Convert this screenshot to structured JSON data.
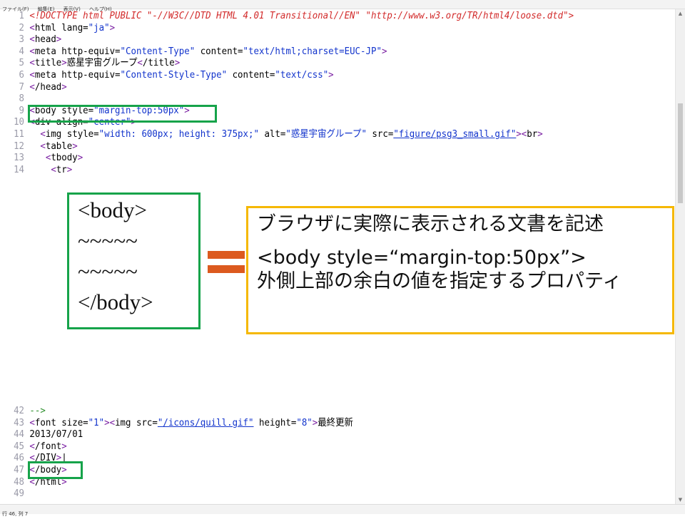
{
  "menu": [
    "ファイル(F)",
    "編集(E)",
    "表示(V)",
    "ヘルプ(H)"
  ],
  "status": "行 46, 列 7",
  "code_top": [
    {
      "n": "1",
      "html": "<span class=\"doctype\">&lt;!DOCTYPE html PUBLIC \"-//W3C//DTD HTML 4.01 Transitional//EN\" \"http://www.w3.org/TR/html4/loose.dtd\"&gt;</span>"
    },
    {
      "n": "2",
      "html": "<span class=\"bracket\">&lt;</span>html lang=<span class=\"val\">\"ja\"</span><span class=\"bracket\">&gt;</span>"
    },
    {
      "n": "3",
      "html": "<span class=\"bracket\">&lt;</span>head<span class=\"bracket\">&gt;</span>"
    },
    {
      "n": "4",
      "html": "<span class=\"bracket\">&lt;</span>meta http-equiv=<span class=\"val\">\"Content-Type\"</span> content=<span class=\"val\">\"text/html;charset=EUC-JP\"</span><span class=\"bracket\">&gt;</span>"
    },
    {
      "n": "5",
      "html": "<span class=\"bracket\">&lt;</span>title<span class=\"bracket\">&gt;</span>惑星宇宙グループ<span class=\"bracket\">&lt;</span>/title<span class=\"bracket\">&gt;</span>"
    },
    {
      "n": "6",
      "html": "<span class=\"bracket\">&lt;</span>meta http-equiv=<span class=\"val\">\"Content-Style-Type\"</span> content=<span class=\"val\">\"text/css\"</span><span class=\"bracket\">&gt;</span>"
    },
    {
      "n": "7",
      "html": "<span class=\"bracket\">&lt;</span>/head<span class=\"bracket\">&gt;</span>"
    },
    {
      "n": "8",
      "html": ""
    },
    {
      "n": "9",
      "html": "<span class=\"bracket\">&lt;</span>body style=<span class=\"val\">\"margin-top:50px\"</span><span class=\"bracket\">&gt;</span>"
    },
    {
      "n": "10",
      "html": "<span class=\"bracket\">&lt;</span>div align=<span class=\"val\">\"center\"</span><span class=\"bracket\">&gt;</span>"
    },
    {
      "n": "11",
      "html": "  <span class=\"bracket\">&lt;</span>img style=<span class=\"val\">\"width: 600px; height: 375px;\"</span> alt=<span class=\"val\">\"惑星宇宙グループ\"</span> src=<span class=\"link\">\"figure/psg3_small.gif\"</span><span class=\"bracket\">&gt;&lt;</span>br<span class=\"bracket\">&gt;</span>"
    },
    {
      "n": "12",
      "html": "  <span class=\"bracket\">&lt;</span>table<span class=\"bracket\">&gt;</span>"
    },
    {
      "n": "13",
      "html": "   <span class=\"bracket\">&lt;</span>tbody<span class=\"bracket\">&gt;</span>"
    },
    {
      "n": "14",
      "html": "    <span class=\"bracket\">&lt;</span>tr<span class=\"bracket\">&gt;</span>"
    }
  ],
  "code_bottom": [
    {
      "n": "42",
      "html": "<span class=\"comment\">--&gt;</span>"
    },
    {
      "n": "43",
      "html": "<span class=\"bracket\">&lt;</span>font size=<span class=\"val\">\"1\"</span><span class=\"bracket\">&gt;&lt;</span>img src=<span class=\"link\">\"/icons/quill.gif\"</span> height=<span class=\"val\">\"8\"</span><span class=\"bracket\">&gt;</span>最終更新"
    },
    {
      "n": "44",
      "html": "2013/07/01"
    },
    {
      "n": "45",
      "html": "<span class=\"bracket\">&lt;</span>/font<span class=\"bracket\">&gt;</span>"
    },
    {
      "n": "46",
      "html": "<span class=\"bracket\">&lt;</span>/DIV<span class=\"bracket\">&gt;</span>|"
    },
    {
      "n": "47",
      "html": "<span class=\"bracket\">&lt;</span>/body<span class=\"bracket\">&gt;</span>"
    },
    {
      "n": "48",
      "html": "<span class=\"bracket\">&lt;</span>/html<span class=\"bracket\">&gt;</span>"
    },
    {
      "n": "49",
      "html": ""
    }
  ],
  "body_box": [
    "<body>",
    "~~~~~",
    "~~~~~",
    "</body>"
  ],
  "description": {
    "line1": "ブラウザに実際に表示される文書を記述",
    "line2": "<body style=“margin-top:50px”>",
    "line3": "外側上部の余白の値を指定するプロパティ"
  }
}
